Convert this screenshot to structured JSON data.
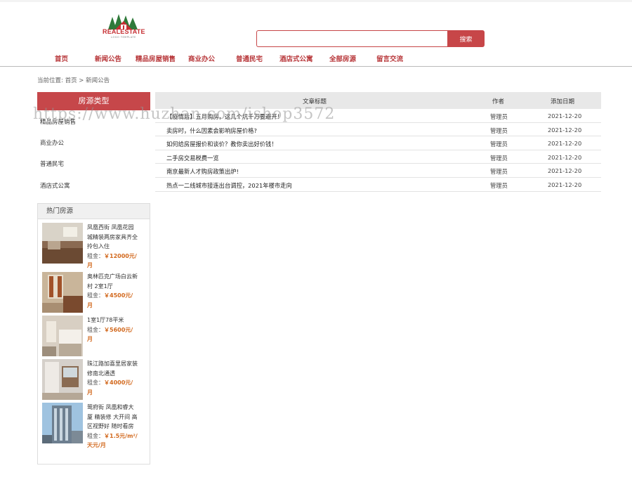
{
  "logo": {
    "text": "REALESTATE",
    "sub": "LOGO TEMPLATE"
  },
  "search": {
    "button_label": "搜索",
    "value": ""
  },
  "nav": [
    {
      "label": "首页"
    },
    {
      "label": "新闻公告"
    },
    {
      "label": "精品房屋销售"
    },
    {
      "label": "商业办公"
    },
    {
      "label": "普通民宅"
    },
    {
      "label": "酒店式公寓"
    },
    {
      "label": "全部房源"
    },
    {
      "label": "留言交流"
    }
  ],
  "breadcrumb": "当前位置: 首页 > 新闻公告",
  "sidebar": {
    "header": "房源类型",
    "categories": [
      "精品房屋销售",
      "商业办公",
      "普通民宅",
      "酒店式公寓"
    ],
    "hot_title": "热门房源",
    "rent_label": "租金：",
    "hot": [
      {
        "title": "凤凰西街 凤凰花园 城精装两房家具齐全拎包入住",
        "price": "￥12000元/月"
      },
      {
        "title": "奥林匹克广场白云新村 2室1厅",
        "price": "￥4500元/月"
      },
      {
        "title": "1室1厅78平米",
        "price": "￥5600元/月"
      },
      {
        "title": "珠江路加喜里居家装修南北通透",
        "price": "￥4000元/月"
      },
      {
        "title": "莺府街 凤凰和睿大厦 精装修 大开间 高区视野好 随时看房",
        "price": "￥1.5元/m²/天元/月"
      }
    ]
  },
  "table": {
    "headers": {
      "title": "文章标题",
      "author": "作者",
      "date": "添加日期"
    },
    "rows": [
      {
        "title": "【疫情后】五月购房，这几个坑千万要避开！",
        "author": "管理员",
        "date": "2021-12-20"
      },
      {
        "title": "卖房时，什么因素会影响房屋价格?",
        "author": "管理员",
        "date": "2021-12-20"
      },
      {
        "title": "如何给房屋报价和谈价？教你卖出好价钱！",
        "author": "管理员",
        "date": "2021-12-20"
      },
      {
        "title": "二手房交易税费一览",
        "author": "管理员",
        "date": "2021-12-20"
      },
      {
        "title": "南京最新人才购房政策出炉!",
        "author": "管理员",
        "date": "2021-12-20"
      },
      {
        "title": "热点一二线城市接连出台调控，2021年楼市走向",
        "author": "管理员",
        "date": "2021-12-20"
      }
    ]
  },
  "watermark": "https://www.huzhan.com/ishop3572",
  "colors": {
    "accent": "#c6474a",
    "nav_text": "#b8373a",
    "price": "#d2691e"
  }
}
